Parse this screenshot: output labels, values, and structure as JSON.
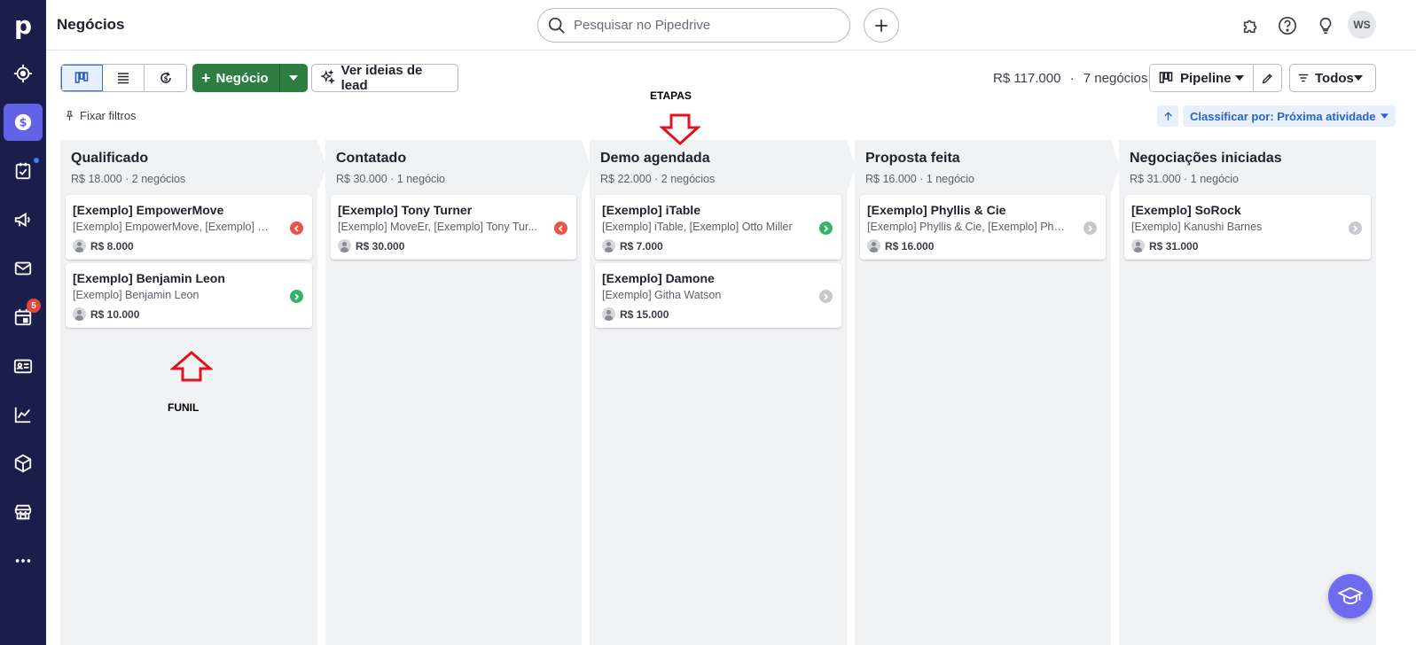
{
  "app": {
    "logo_letter": "p",
    "page_title": "Negócios"
  },
  "nav": {
    "items": [
      {
        "icon": "target-icon",
        "active": false
      },
      {
        "icon": "dollar-icon",
        "active": true
      },
      {
        "icon": "checklist-icon",
        "active": false,
        "dot": true
      },
      {
        "icon": "megaphone-icon",
        "active": false
      },
      {
        "icon": "mail-icon",
        "active": false
      },
      {
        "icon": "calendar-icon",
        "active": false,
        "badge": "5"
      },
      {
        "icon": "contacts-card-icon",
        "active": false
      },
      {
        "icon": "chart-icon",
        "active": false
      },
      {
        "icon": "box-icon",
        "active": false
      },
      {
        "icon": "store-icon",
        "active": false
      },
      {
        "icon": "more-icon",
        "active": false
      }
    ],
    "calendar_badge": "5"
  },
  "search": {
    "placeholder": "Pesquisar no Pipedrive"
  },
  "topbar": {
    "avatar_initials": "WS"
  },
  "toolbar": {
    "new_deal_label": "Negócio",
    "lead_ideas_label": "Ver ideias de lead",
    "summary_value": "R$ 117.000",
    "summary_separator": "·",
    "summary_count": "7 negócios",
    "pipeline_label": "Pipeline",
    "filter_label": "Todos",
    "fix_filters_label": "Fixar filtros",
    "sort_label": "Classificar por: Próxima atividade"
  },
  "stages": [
    {
      "title": "Qualificado",
      "meta": "R$ 18.000 · 2 negócios",
      "deals": [
        {
          "title": "[Exemplo] EmpowerMove",
          "subtitle": "[Exemplo] EmpowerMove, [Exemplo] Gl...",
          "value": "R$ 8.000",
          "status": "red"
        },
        {
          "title": "[Exemplo] Benjamin Leon",
          "subtitle": "[Exemplo] Benjamin Leon",
          "value": "R$ 10.000",
          "status": "green"
        }
      ]
    },
    {
      "title": "Contatado",
      "meta": "R$ 30.000 · 1 negócio",
      "deals": [
        {
          "title": "[Exemplo] Tony Turner",
          "subtitle": "[Exemplo] MoveEr, [Exemplo] Tony Tur...",
          "value": "R$ 30.000",
          "status": "red"
        }
      ]
    },
    {
      "title": "Demo agendada",
      "meta": "R$ 22.000 · 2 negócios",
      "deals": [
        {
          "title": "[Exemplo] iTable",
          "subtitle": "[Exemplo] iTable, [Exemplo] Otto Miller",
          "value": "R$ 7.000",
          "status": "green"
        },
        {
          "title": "[Exemplo] Damone",
          "subtitle": "[Exemplo] Githa Watson",
          "value": "R$ 15.000",
          "status": "grey"
        }
      ]
    },
    {
      "title": "Proposta feita",
      "meta": "R$ 16.000 · 1 negócio",
      "deals": [
        {
          "title": "[Exemplo] Phyllis & Cie",
          "subtitle": "[Exemplo] Phyllis & Cie, [Exemplo] Phyll...",
          "value": "R$ 16.000",
          "status": "grey"
        }
      ]
    },
    {
      "title": "Negociações iniciadas",
      "meta": "R$ 31.000 · 1 negócio",
      "deals": [
        {
          "title": "[Exemplo] SoRock",
          "subtitle": "[Exemplo] Kanushi Barnes",
          "value": "R$ 31.000",
          "status": "grey"
        }
      ]
    }
  ],
  "annotations": {
    "top_label": "ETAPAS",
    "bottom_label": "FUNIL",
    "arrow_color": "#e0141e"
  },
  "colors": {
    "nav_bg": "#1b1e4b",
    "nav_active": "#6262e6",
    "primary_green": "#2e7d43",
    "link_blue": "#2a63c5",
    "status_red": "#e9554a",
    "status_green": "#36b36b",
    "status_grey": "#c8c9ce"
  }
}
